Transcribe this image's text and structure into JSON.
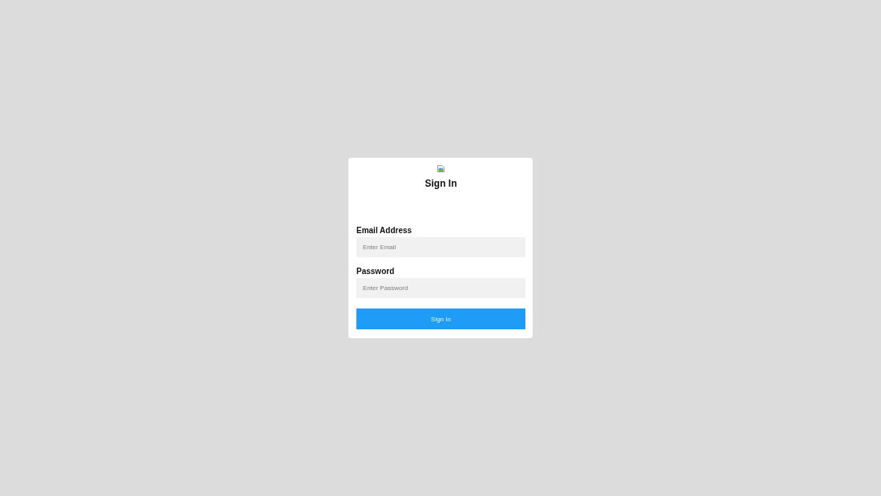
{
  "header": {
    "title": "Sign In"
  },
  "fields": [
    {
      "label": "Email Address",
      "placeholder": "Enter Email"
    },
    {
      "label": "Password",
      "placeholder": "Enter Password"
    }
  ],
  "submit_button": {
    "label": "Sign In"
  }
}
